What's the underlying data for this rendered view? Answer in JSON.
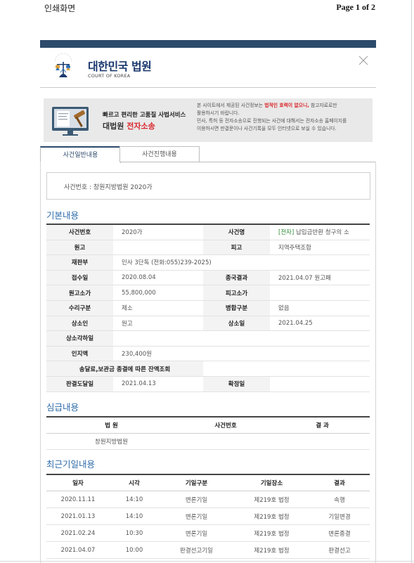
{
  "print_header": {
    "left": "인쇄화면",
    "right": "Page 1 of 2"
  },
  "court": {
    "name_ko": "대한민국 법원",
    "name_en": "COURT OF KOREA",
    "emblem_text": "대한민국법원"
  },
  "banner": {
    "line1": "빠르고 편리한 고품질 사법서비스",
    "line2_a": "대법원 ",
    "line2_b": "전자소송",
    "note1_a": "본 사이트에서 제공된 사건정보는 ",
    "note1_b": "법적인 효력이 없으니,",
    "note1_c": " 참고자료로만",
    "note2": "활용하시기 바랍니다.",
    "note3": "민사, 특허 등 전자소송으로 진행되는 사건에 대해서는 전자소송 홈페이지를",
    "note4": "이용하시면 판결문이나 사건기록을 모두 인터넷으로 보실 수 있습니다."
  },
  "tabs": {
    "general": "사건일반내용",
    "progress": "사건진행내용"
  },
  "case_box": {
    "label": "사건번호 : 창원지방법원 2020가"
  },
  "sections": {
    "basic": "기본내용",
    "trial": "심급내용",
    "recent": "최근기일내용"
  },
  "basic": {
    "case_no_label": "사건번호",
    "case_no": "2020가",
    "case_name_label": "사건명",
    "case_name_tag": "[전자]",
    "case_name": " 납입금반환 청구의 소",
    "plaintiff_label": "원고",
    "plaintiff": "",
    "defendant_label": "피고",
    "defendant": "지역주택조합",
    "division_label": "재판부",
    "division": "민사 3단독 (전화:055)239-2025)",
    "received_label": "접수일",
    "received": "2020.08.04",
    "final_label": "종국결과",
    "final": "2021.04.07 원고패",
    "claim_p_label": "원고소가",
    "claim_p": "55,800,000",
    "claim_d_label": "피고소가",
    "claim_d": "",
    "receipt_type_label": "수리구분",
    "receipt_type": "제소",
    "merge_label": "병합구분",
    "merge": "없음",
    "appellant_label": "상소인",
    "appellant": "원고",
    "appeal_date_label": "상소일",
    "appeal_date": "2021.04.25",
    "appeal_dismiss_label": "상소각하일",
    "appeal_dismiss": "",
    "stamp_label": "인지액",
    "stamp": "230,400원",
    "deposit_label": "송달료,보관금 종결에 따른 잔액조회",
    "deposit": "",
    "judgment_delivery_label": "판결도달일",
    "judgment_delivery": "2021.04.13",
    "confirmed_label": "확정일",
    "confirmed": ""
  },
  "trial": {
    "headers": [
      "법 원",
      "사건번호",
      "결 과"
    ],
    "rows": [
      [
        "창원지방법원",
        "",
        ""
      ]
    ]
  },
  "recent": {
    "headers": [
      "일자",
      "시각",
      "기일구분",
      "기일장소",
      "결과"
    ],
    "rows": [
      [
        "2020.11.11",
        "14:10",
        "변론기일",
        "제219호 법정",
        "속행"
      ],
      [
        "2021.01.13",
        "14:10",
        "변론기일",
        "제219호 법정",
        "기일변경"
      ],
      [
        "2021.02.24",
        "10:30",
        "변론기일",
        "제219호 법정",
        "변론종결"
      ],
      [
        "2021.04.07",
        "10:00",
        "판결선고기일",
        "제219호 법정",
        "판결선고"
      ]
    ]
  },
  "colors": {
    "navy": "#2c4a6a",
    "section_blue": "#2d6ba8",
    "emphasis_red": "#d9262b",
    "tag_green": "#2f8a35"
  },
  "icons": {
    "close": "close-icon",
    "emblem": "court-emblem-icon",
    "banner_art": "monitor-gavel-icon"
  }
}
